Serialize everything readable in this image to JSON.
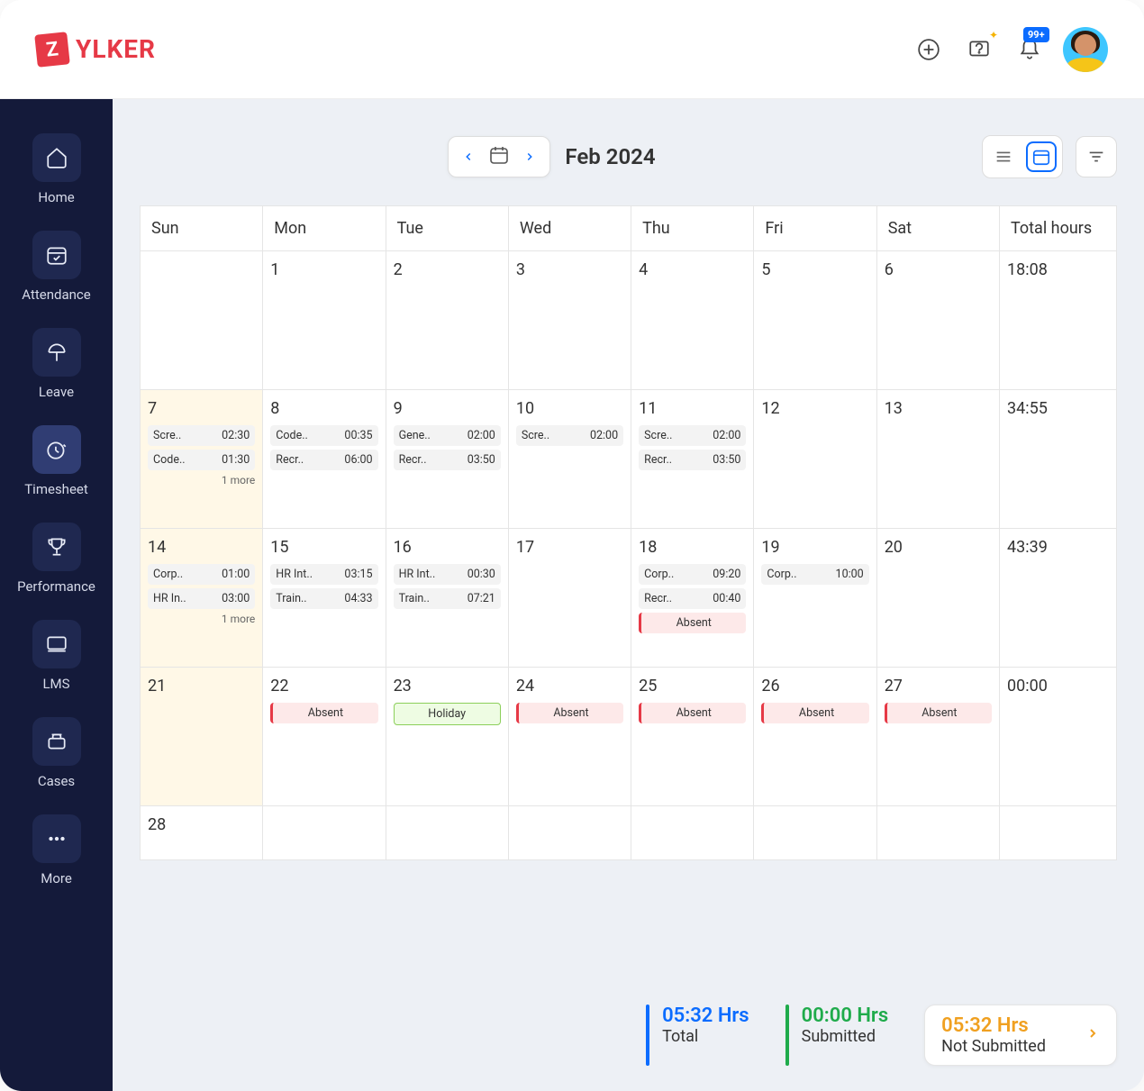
{
  "brand": {
    "mark": "Z",
    "name": "YLKER"
  },
  "header": {
    "notification_badge": "99+"
  },
  "sidebar": {
    "items": [
      {
        "label": "Home"
      },
      {
        "label": "Attendance"
      },
      {
        "label": "Leave"
      },
      {
        "label": "Timesheet"
      },
      {
        "label": "Performance"
      },
      {
        "label": "LMS"
      },
      {
        "label": "Cases"
      },
      {
        "label": "More"
      }
    ]
  },
  "toolbar": {
    "month": "Feb 2024"
  },
  "calendar": {
    "headers": [
      "Sun",
      "Mon",
      "Tue",
      "Wed",
      "Thu",
      "Fri",
      "Sat",
      "Total hours"
    ],
    "weeks": [
      {
        "days": [
          {
            "num": ""
          },
          {
            "num": "1"
          },
          {
            "num": "2"
          },
          {
            "num": "3"
          },
          {
            "num": "4"
          },
          {
            "num": "5"
          },
          {
            "num": "6"
          }
        ],
        "total": "18:08"
      },
      {
        "days": [
          {
            "num": "7",
            "hl": true,
            "entries": [
              {
                "label": "Scre..",
                "time": "02:30"
              },
              {
                "label": "Code..",
                "time": "01:30"
              }
            ],
            "more": "1 more"
          },
          {
            "num": "8",
            "entries": [
              {
                "label": "Code..",
                "time": "00:35"
              },
              {
                "label": "Recr..",
                "time": "06:00"
              }
            ]
          },
          {
            "num": "9",
            "entries": [
              {
                "label": "Gene..",
                "time": "02:00"
              },
              {
                "label": "Recr..",
                "time": "03:50"
              }
            ]
          },
          {
            "num": "10",
            "entries": [
              {
                "label": "Scre..",
                "time": "02:00"
              }
            ]
          },
          {
            "num": "11",
            "entries": [
              {
                "label": "Scre..",
                "time": "02:00"
              },
              {
                "label": "Recr..",
                "time": "03:50"
              }
            ]
          },
          {
            "num": "12"
          },
          {
            "num": "13"
          }
        ],
        "total": "34:55"
      },
      {
        "days": [
          {
            "num": "14",
            "hl": true,
            "entries": [
              {
                "label": "Corp..",
                "time": "01:00"
              },
              {
                "label": "HR In..",
                "time": "03:00"
              }
            ],
            "more": "1 more"
          },
          {
            "num": "15",
            "entries": [
              {
                "label": "HR Int..",
                "time": "03:15"
              },
              {
                "label": "Train..",
                "time": "04:33"
              }
            ]
          },
          {
            "num": "16",
            "entries": [
              {
                "label": "HR Int..",
                "time": "00:30"
              },
              {
                "label": "Train..",
                "time": "07:21"
              }
            ]
          },
          {
            "num": "17"
          },
          {
            "num": "18",
            "entries": [
              {
                "label": "Corp..",
                "time": "09:20"
              },
              {
                "label": "Recr..",
                "time": "00:40"
              },
              {
                "label": "Absent",
                "kind": "absent"
              }
            ]
          },
          {
            "num": "19",
            "entries": [
              {
                "label": "Corp..",
                "time": "10:00"
              }
            ]
          },
          {
            "num": "20"
          }
        ],
        "total": "43:39"
      },
      {
        "days": [
          {
            "num": "21",
            "hl": true
          },
          {
            "num": "22",
            "entries": [
              {
                "label": "Absent",
                "kind": "absent"
              }
            ]
          },
          {
            "num": "23",
            "entries": [
              {
                "label": "Holiday",
                "kind": "holiday"
              }
            ]
          },
          {
            "num": "24",
            "entries": [
              {
                "label": "Absent",
                "kind": "absent"
              }
            ]
          },
          {
            "num": "25",
            "entries": [
              {
                "label": "Absent",
                "kind": "absent"
              }
            ]
          },
          {
            "num": "26",
            "entries": [
              {
                "label": "Absent",
                "kind": "absent"
              }
            ]
          },
          {
            "num": "27",
            "entries": [
              {
                "label": "Absent",
                "kind": "absent"
              }
            ]
          }
        ],
        "total": "00:00"
      },
      {
        "days": [
          {
            "num": "28"
          },
          {
            "num": ""
          },
          {
            "num": ""
          },
          {
            "num": ""
          },
          {
            "num": ""
          },
          {
            "num": ""
          },
          {
            "num": ""
          }
        ],
        "total": ""
      }
    ]
  },
  "summary": {
    "total": {
      "hrs": "05:32 Hrs",
      "label": "Total"
    },
    "submitted": {
      "hrs": "00:00 Hrs",
      "label": "Submitted"
    },
    "unsubmitted": {
      "hrs": "05:32 Hrs",
      "label": "Not Submitted"
    }
  }
}
